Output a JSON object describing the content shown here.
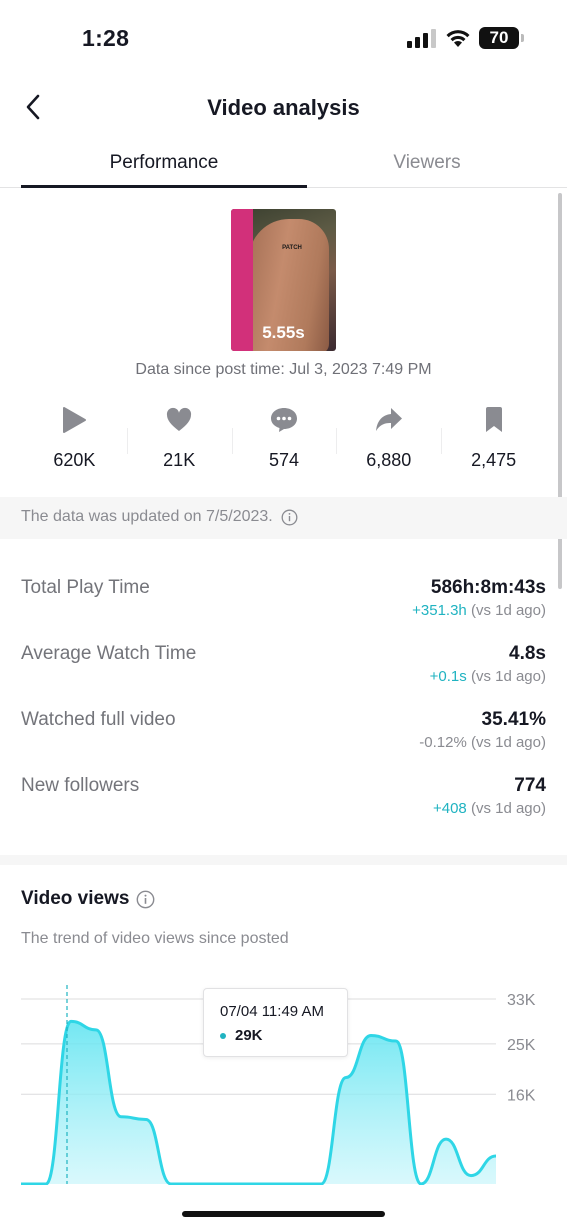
{
  "status_bar": {
    "time": "1:28",
    "battery": "70"
  },
  "header": {
    "title": "Video analysis"
  },
  "tabs": [
    {
      "label": "Performance",
      "active": true
    },
    {
      "label": "Viewers",
      "active": false
    }
  ],
  "video": {
    "duration": "5.55s",
    "patch_text": "PATCH",
    "post_time": "Data since post time: Jul 3, 2023 7:49 PM"
  },
  "stats": [
    {
      "icon": "play-icon",
      "value": "620K"
    },
    {
      "icon": "heart-icon",
      "value": "21K"
    },
    {
      "icon": "comment-icon",
      "value": "574"
    },
    {
      "icon": "share-icon",
      "value": "6,880"
    },
    {
      "icon": "bookmark-icon",
      "value": "2,475"
    }
  ],
  "update_note": "The data was updated on 7/5/2023.",
  "metrics": [
    {
      "label": "Total Play Time",
      "value": "586h:8m:43s",
      "delta": "+351.3h",
      "delta_suffix": " (vs 1d ago)",
      "positive": true
    },
    {
      "label": "Average Watch Time",
      "value": "4.8s",
      "delta": "+0.1s",
      "delta_suffix": " (vs 1d ago)",
      "positive": true
    },
    {
      "label": "Watched full video",
      "value": "35.41%",
      "delta": "-0.12%",
      "delta_suffix": " (vs 1d ago)",
      "positive": false
    },
    {
      "label": "New followers",
      "value": "774",
      "delta": "+408",
      "delta_suffix": " (vs 1d ago)",
      "positive": true
    }
  ],
  "video_views": {
    "title": "Video views",
    "subtitle": "The trend of video views since posted",
    "tooltip": {
      "date": "07/04 11:49 AM",
      "value": "29K"
    }
  },
  "chart_data": {
    "type": "area",
    "title": "Video views",
    "y_ticks": [
      "33K",
      "25K",
      "16K"
    ],
    "ylim": [
      0,
      33000
    ],
    "grid": true,
    "color": "#4fe0ef",
    "x": [
      "07/04 11:49 AM"
    ],
    "series": [
      {
        "values": [
          0,
          0,
          29000,
          27500,
          12000,
          11500,
          0,
          0,
          0,
          0,
          0,
          0,
          0,
          19000,
          26500,
          25500,
          0,
          8000,
          1500,
          5000
        ]
      }
    ],
    "highlight": {
      "x": "07/04 11:49 AM",
      "value": 29000,
      "label": "29K"
    }
  }
}
